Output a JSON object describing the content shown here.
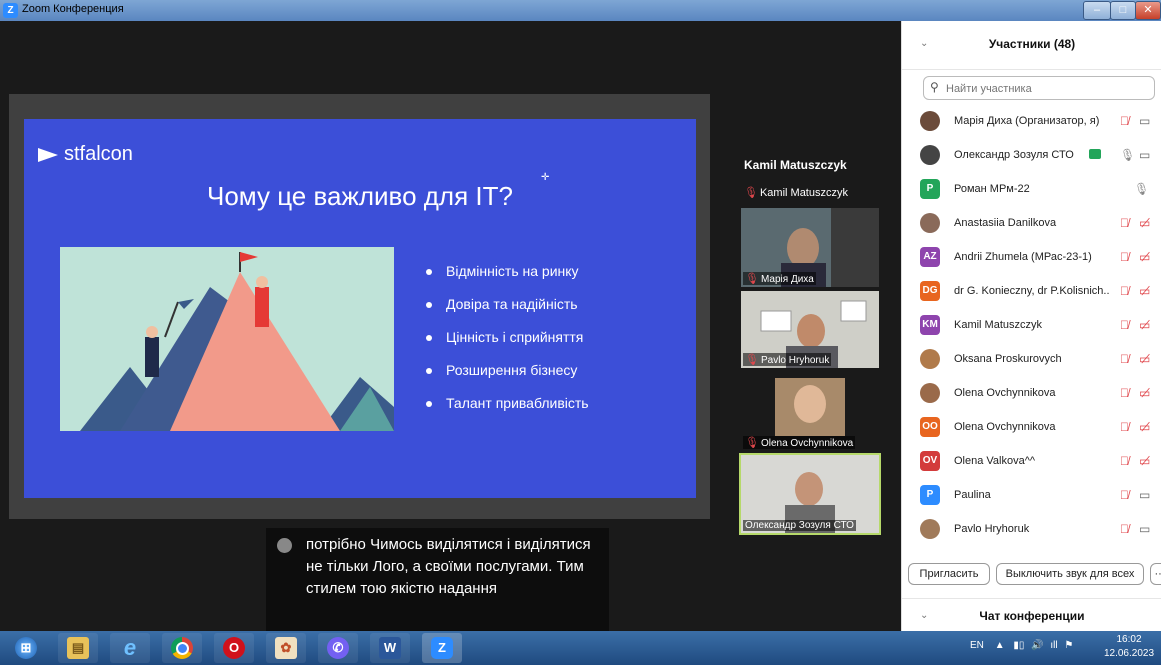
{
  "window": {
    "title": "Zoom Конференция",
    "app_icon": "Z",
    "controls": [
      "minimize-icon",
      "maximize-icon",
      "close-icon"
    ]
  },
  "slide": {
    "logo": "stfalcon",
    "title": "Чому це важливо для IT?",
    "bullets": [
      "Відмінність на ринку",
      "Довіра та надійність",
      "Цінність і сприйняття",
      "Розширення бізнесу",
      "Талант привабливість"
    ]
  },
  "speaker": {
    "name": "Kamil Matuszczyk",
    "label": "Kamil Matuszczyk"
  },
  "video_tiles": [
    {
      "name": "Марія Диха",
      "muted": true
    },
    {
      "name": "Pavlo Hryhoruk",
      "muted": true
    },
    {
      "name": "Olena Ovchynnikova",
      "muted": true
    },
    {
      "name": "Олександр Зозуля СТО",
      "muted": false,
      "active": true
    }
  ],
  "caption": {
    "text": "потрібно Чимось виділятися і виділятися не тільки Лого, а своїми послугами. Тим стилем тою якістю надання"
  },
  "participants_panel": {
    "title": "Участники (48)",
    "search_placeholder": "Найти участника",
    "participants": [
      {
        "name": "Марія Диха (Организатор, я)",
        "avatar": "photo",
        "color": "#6b4b3a",
        "mic": "muted",
        "video": "on"
      },
      {
        "name": "Олександр Зозуля СТО",
        "avatar": "photo",
        "color": "#444444",
        "mic": "on",
        "video": "on",
        "share": true
      },
      {
        "name": "Роман МРм-22",
        "avatar": "P",
        "color": "#23a55a",
        "mic": "on",
        "video": "none"
      },
      {
        "name": "Anastasiia Danilkova",
        "avatar": "photo",
        "color": "#8a6a5a",
        "mic": "muted",
        "video": "off"
      },
      {
        "name": "Andrii Zhumela (МРас-23-1)",
        "avatar": "AZ",
        "color": "#8e44ad",
        "mic": "muted",
        "video": "off"
      },
      {
        "name": "dr G. Konieczny, dr P.Kolisnich...",
        "avatar": "DG",
        "color": "#e8651f",
        "mic": "muted",
        "video": "off"
      },
      {
        "name": "Kamil Matuszczyk",
        "avatar": "KM",
        "color": "#8e44ad",
        "mic": "muted",
        "video": "off"
      },
      {
        "name": "Oksana Proskurovych",
        "avatar": "photo",
        "color": "#b07a4a",
        "mic": "muted",
        "video": "off"
      },
      {
        "name": "Olena Ovchynnikova",
        "avatar": "photo",
        "color": "#9a6a4a",
        "mic": "muted",
        "video": "off"
      },
      {
        "name": "Olena Ovchynnikova",
        "avatar": "OO",
        "color": "#e8651f",
        "mic": "muted",
        "video": "off"
      },
      {
        "name": "Olena Valkova^^",
        "avatar": "OV",
        "color": "#d33b3b",
        "mic": "muted",
        "video": "off"
      },
      {
        "name": "Paulina",
        "avatar": "P",
        "color": "#2d8cff",
        "mic": "muted",
        "video": "on"
      },
      {
        "name": "Pavlo Hryhoruk",
        "avatar": "photo",
        "color": "#a07a5a",
        "mic": "muted",
        "video": "on"
      }
    ],
    "invite_label": "Пригласить",
    "mute_all_label": "Выключить звук для всех",
    "more_label": "···",
    "chat_title": "Чат конференции"
  },
  "taskbar": {
    "apps": [
      "windows-start-icon",
      "file-explorer-icon",
      "internet-explorer-icon",
      "chrome-icon",
      "opera-icon",
      "paint-icon",
      "viber-icon",
      "word-icon",
      "zoom-icon"
    ],
    "language": "EN",
    "time": "16:02",
    "date": "12.06.2023"
  }
}
